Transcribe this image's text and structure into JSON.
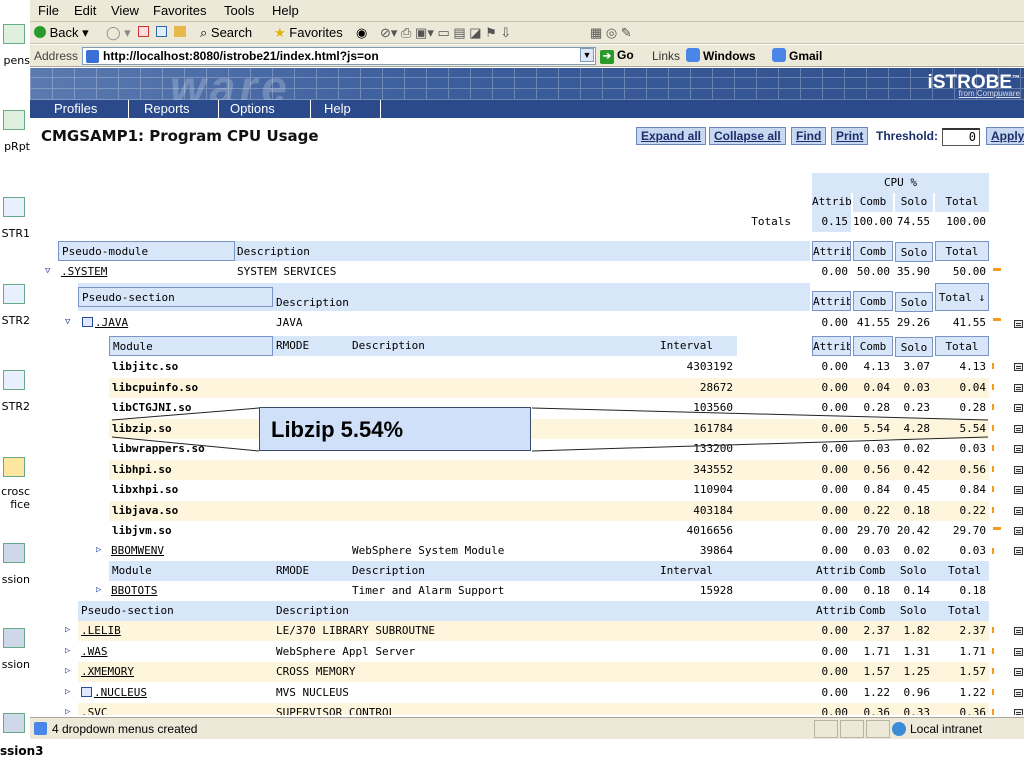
{
  "desktop": {
    "icons": [
      {
        "label": "pens"
      },
      {
        "label": "pRpt"
      },
      {
        "label": "STR1"
      },
      {
        "label": "STR2"
      },
      {
        "label": "STR2"
      },
      {
        "label": "crosc fice"
      },
      {
        "label": "ssion"
      },
      {
        "label": "ssion"
      }
    ],
    "bottom_label": "ssion3"
  },
  "browser": {
    "menu": [
      "File",
      "Edit",
      "View",
      "Favorites",
      "Tools",
      "Help"
    ],
    "toolbar": {
      "back": "Back",
      "search": "Search",
      "favorites": "Favorites"
    },
    "address": {
      "label": "Address",
      "url": "http://localhost:8080/istrobe21/index.html?js=on",
      "go": "Go",
      "links": "Links",
      "link_items": [
        "Windows",
        "Gmail"
      ]
    },
    "status": {
      "text": "4 dropdown menus created",
      "zone": "Local intranet"
    }
  },
  "app": {
    "brand": "iSTROBE",
    "brand_tm": "™",
    "brand_sub": "from Compuware",
    "nav": [
      "Profiles",
      "Reports",
      "Options",
      "Help"
    ],
    "title": "CMGSAMP1: Program CPU Usage",
    "actions": [
      "Expand all",
      "Collapse all",
      "Find",
      "Print"
    ],
    "threshold_label": "Threshold:",
    "threshold_value": "0",
    "apply": "Apply"
  },
  "report": {
    "cpu_header": "CPU %",
    "col_attrib": "Attrib",
    "col_comb": "Comb",
    "col_solo": "Solo",
    "col_total": "Total",
    "col_total_sorted": "Total ↓",
    "totals_label": "Totals",
    "totals": {
      "attrib": "0.15",
      "comb": "100.00",
      "solo": "74.55",
      "total": "100.00"
    },
    "hdr_pseudo_module": "Pseudo-module",
    "hdr_description": "Description",
    "hdr_pseudo_section": "Pseudo-section",
    "hdr_module": "Module",
    "hdr_rmode": "RMODE",
    "hdr_interval": "Interval",
    "system_row": {
      "name": ".SYSTEM",
      "desc": "SYSTEM SERVICES",
      "attrib": "0.00",
      "comb": "50.00",
      "solo": "35.90",
      "total": "50.00"
    },
    "java_row": {
      "name": ".JAVA",
      "desc": "JAVA",
      "attrib": "0.00",
      "comb": "41.55",
      "solo": "29.26",
      "total": "41.55"
    },
    "modules": [
      {
        "name": "libjitc.so",
        "interval": "4303192",
        "attrib": "0.00",
        "comb": "4.13",
        "solo": "3.07",
        "total": "4.13"
      },
      {
        "name": "libcpuinfo.so",
        "interval": "28672",
        "attrib": "0.00",
        "comb": "0.04",
        "solo": "0.03",
        "total": "0.04"
      },
      {
        "name": "libCTGJNI.so",
        "interval": "103560",
        "attrib": "0.00",
        "comb": "0.28",
        "solo": "0.23",
        "total": "0.28"
      },
      {
        "name": "libzip.so",
        "interval": "161784",
        "attrib": "0.00",
        "comb": "5.54",
        "solo": "4.28",
        "total": "5.54"
      },
      {
        "name": "libwrappers.so",
        "interval": "133200",
        "attrib": "0.00",
        "comb": "0.03",
        "solo": "0.02",
        "total": "0.03"
      },
      {
        "name": "libhpi.so",
        "interval": "343552",
        "attrib": "0.00",
        "comb": "0.56",
        "solo": "0.42",
        "total": "0.56"
      },
      {
        "name": "libxhpi.so",
        "interval": "110904",
        "attrib": "0.00",
        "comb": "0.84",
        "solo": "0.45",
        "total": "0.84"
      },
      {
        "name": "libjava.so",
        "interval": "403184",
        "attrib": "0.00",
        "comb": "0.22",
        "solo": "0.18",
        "total": "0.22"
      },
      {
        "name": "libjvm.so",
        "interval": "4016656",
        "attrib": "0.00",
        "comb": "29.70",
        "solo": "20.42",
        "total": "29.70"
      }
    ],
    "bbomwenv": {
      "name": "BBOMWENV",
      "desc": "WebSphere System Module",
      "interval": "39864",
      "attrib": "0.00",
      "comb": "0.03",
      "solo": "0.02",
      "total": "0.03"
    },
    "bbotots": {
      "name": "BBOTOTS",
      "desc": "Timer and Alarm Support",
      "interval": "15928",
      "attrib": "0.00",
      "comb": "0.18",
      "solo": "0.14",
      "total": "0.18"
    },
    "sections": [
      {
        "name": ".LELIB",
        "desc": "LE/370 LIBRARY SUBROUTNE",
        "attrib": "0.00",
        "comb": "2.37",
        "solo": "1.82",
        "total": "2.37"
      },
      {
        "name": ".WAS",
        "desc": "WebSphere Appl Server",
        "attrib": "0.00",
        "comb": "1.71",
        "solo": "1.31",
        "total": "1.71"
      },
      {
        "name": ".XMEMORY",
        "desc": "CROSS MEMORY",
        "attrib": "0.00",
        "comb": "1.57",
        "solo": "1.25",
        "total": "1.57"
      },
      {
        "name": ".NUCLEUS",
        "desc": "MVS NUCLEUS",
        "attrib": "0.00",
        "comb": "1.22",
        "solo": "0.96",
        "total": "1.22"
      },
      {
        "name": ".SVC",
        "desc": "SUPERVISOR CONTROL",
        "attrib": "0.00",
        "comb": "0.36",
        "solo": "0.33",
        "total": "0.36"
      }
    ],
    "callout": "Libzip 5.54%"
  },
  "colors": {
    "header_bg": "#d8e6fa",
    "row_alt": "#fdf6dc",
    "nav_bg": "#2a4a8c",
    "indicator": "#f59a1a"
  }
}
